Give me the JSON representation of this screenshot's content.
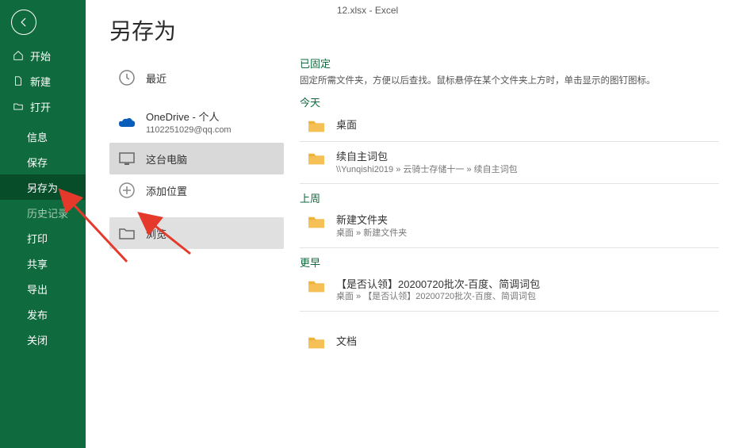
{
  "titleBar": "12.xlsx  -  Excel",
  "pageTitle": "另存为",
  "sidebar": {
    "items": [
      {
        "label": "开始",
        "icon": "home",
        "active": false
      },
      {
        "label": "新建",
        "icon": "new",
        "active": false
      },
      {
        "label": "打开",
        "icon": "open",
        "active": false
      },
      {
        "label": "信息",
        "icon": "",
        "active": false
      },
      {
        "label": "保存",
        "icon": "",
        "active": false
      },
      {
        "label": "另存为",
        "icon": "",
        "active": true
      },
      {
        "label": "历史记录",
        "icon": "",
        "active": false,
        "muted": true
      },
      {
        "label": "打印",
        "icon": "",
        "active": false
      },
      {
        "label": "共享",
        "icon": "",
        "active": false
      },
      {
        "label": "导出",
        "icon": "",
        "active": false
      },
      {
        "label": "发布",
        "icon": "",
        "active": false
      },
      {
        "label": "关闭",
        "icon": "",
        "active": false
      }
    ]
  },
  "locations": {
    "recent": {
      "label": "最近"
    },
    "onedrive": {
      "label": "OneDrive - 个人",
      "sub": "1102251029@qq.com"
    },
    "thispc": {
      "label": "这台电脑"
    },
    "addlocation": {
      "label": "添加位置"
    },
    "browse": {
      "label": "浏览"
    }
  },
  "rightCol": {
    "pinned": {
      "header": "已固定",
      "sub": "固定所需文件夹，方便以后查找。鼠标悬停在某个文件夹上方时，单击显示的图钉图标。"
    },
    "groups": [
      {
        "header": "今天",
        "items": [
          {
            "name": "桌面"
          },
          {
            "name": "续自主词包",
            "path": "\\\\Yunqishi2019 » 云骑士存储十一 » 续自主词包"
          }
        ]
      },
      {
        "header": "上周",
        "items": [
          {
            "name": "新建文件夹",
            "path": "桌面 » 新建文件夹"
          }
        ]
      },
      {
        "header": "更早",
        "items": [
          {
            "name": "【是否认领】20200720批次-百度、简调词包",
            "path": "桌面 » 【是否认领】20200720批次-百度、简调词包"
          },
          {
            "name": "文档"
          }
        ]
      }
    ]
  }
}
